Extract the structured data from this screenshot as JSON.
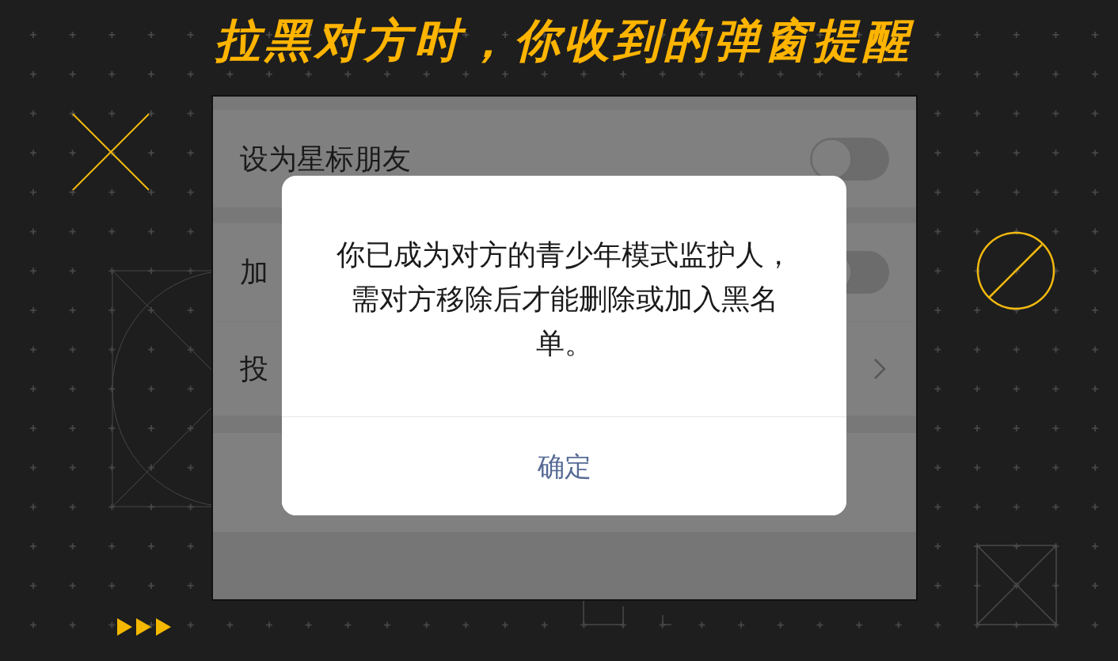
{
  "title": "拉黑对方时，你收到的弹窗提醒",
  "settings": [
    {
      "kind": "toggle",
      "label": "设为星标朋友",
      "on": false
    },
    {
      "kind": "toggle",
      "label": "加",
      "on": false
    },
    {
      "kind": "link",
      "label": "投"
    }
  ],
  "dialog": {
    "message": "你已成为对方的青少年模式监护人，需对方移除后才能删除或加入黑名单。",
    "button": "确定"
  }
}
